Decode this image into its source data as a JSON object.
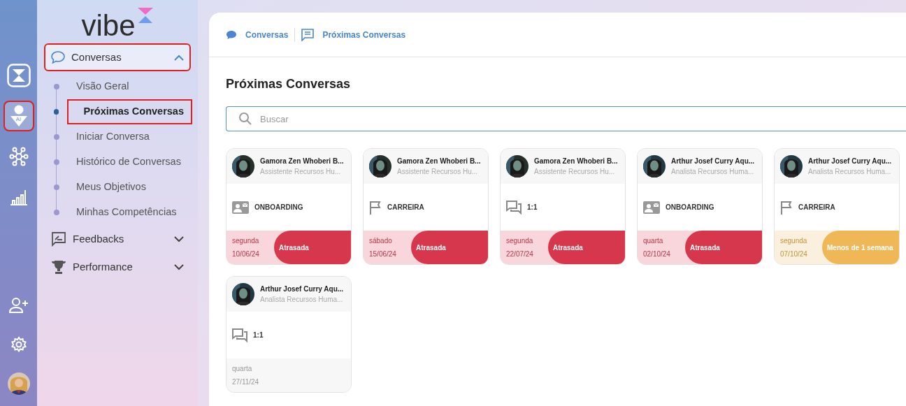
{
  "rail": {
    "items": [
      {
        "kind": "logo",
        "selected": false,
        "highlighted": false
      },
      {
        "kind": "ai-person",
        "selected": true,
        "highlighted": true
      },
      {
        "kind": "network",
        "selected": false,
        "highlighted": false
      },
      {
        "kind": "chart",
        "selected": false,
        "highlighted": false
      }
    ],
    "bottom": [
      {
        "kind": "add-user"
      },
      {
        "kind": "settings"
      },
      {
        "kind": "avatar"
      }
    ],
    "ai_label": "AI"
  },
  "brand": "vibe",
  "menu": [
    {
      "label": "Conversas",
      "kind": "chat",
      "expanded": true,
      "highlighted": true,
      "children": [
        {
          "label": "Visão Geral",
          "selected": false,
          "highlighted": false
        },
        {
          "label": "Próximas Conversas",
          "selected": true,
          "highlighted": true
        },
        {
          "label": "Iniciar Conversa",
          "selected": false,
          "highlighted": false
        },
        {
          "label": "Histórico de Conversas",
          "selected": false,
          "highlighted": false
        },
        {
          "label": "Meus Objetivos",
          "selected": false,
          "highlighted": false
        },
        {
          "label": "Minhas Competências",
          "selected": false,
          "highlighted": false
        }
      ]
    },
    {
      "label": "Feedbacks",
      "kind": "feedback",
      "expanded": false,
      "highlighted": false
    },
    {
      "label": "Performance",
      "kind": "trophy",
      "expanded": false,
      "highlighted": false
    }
  ],
  "breadcrumb": [
    {
      "label": "Conversas",
      "kind": "bubble"
    },
    {
      "label": "Próximas Conversas",
      "kind": "note"
    }
  ],
  "title": "Próximas Conversas",
  "search": {
    "placeholder": "Buscar"
  },
  "cards": [
    {
      "name": "Gamora Zen Whoberi B...",
      "role": "Assistente Recursos Hu...",
      "kind": "onboarding",
      "type_label": "ONBOARDING",
      "day": "segunda",
      "date": "10/06/24",
      "status": {
        "kind": "late",
        "label": "Atrasada"
      }
    },
    {
      "name": "Gamora Zen Whoberi B...",
      "role": "Assistente Recursos Hu...",
      "kind": "career",
      "type_label": "CARREIRA",
      "day": "sábado",
      "date": "15/06/24",
      "status": {
        "kind": "late",
        "label": "Atrasada"
      }
    },
    {
      "name": "Gamora Zen Whoberi B...",
      "role": "Assistente Recursos Hu...",
      "kind": "one-on-one",
      "type_label": "1:1",
      "day": "segunda",
      "date": "22/07/24",
      "status": {
        "kind": "late",
        "label": "Atrasada"
      }
    },
    {
      "name": "Arthur Josef Curry Aqu...",
      "role": "Analista Recursos Huma...",
      "kind": "onboarding",
      "type_label": "ONBOARDING",
      "day": "quarta",
      "date": "02/10/24",
      "status": {
        "kind": "late",
        "label": "Atrasada"
      }
    },
    {
      "name": "Arthur Josef Curry Aqu...",
      "role": "Analista Recursos Huma...",
      "kind": "career",
      "type_label": "CARREIRA",
      "day": "segunda",
      "date": "07/10/24",
      "status": {
        "kind": "soon",
        "label": "Menos de 1 semana"
      }
    },
    {
      "name": "Arthur Josef Curry Aqu...",
      "role": "Analista Recursos Huma...",
      "kind": "one-on-one",
      "type_label": "1:1",
      "day": "quarta",
      "date": "27/11/24",
      "status": {
        "kind": "none"
      }
    }
  ]
}
